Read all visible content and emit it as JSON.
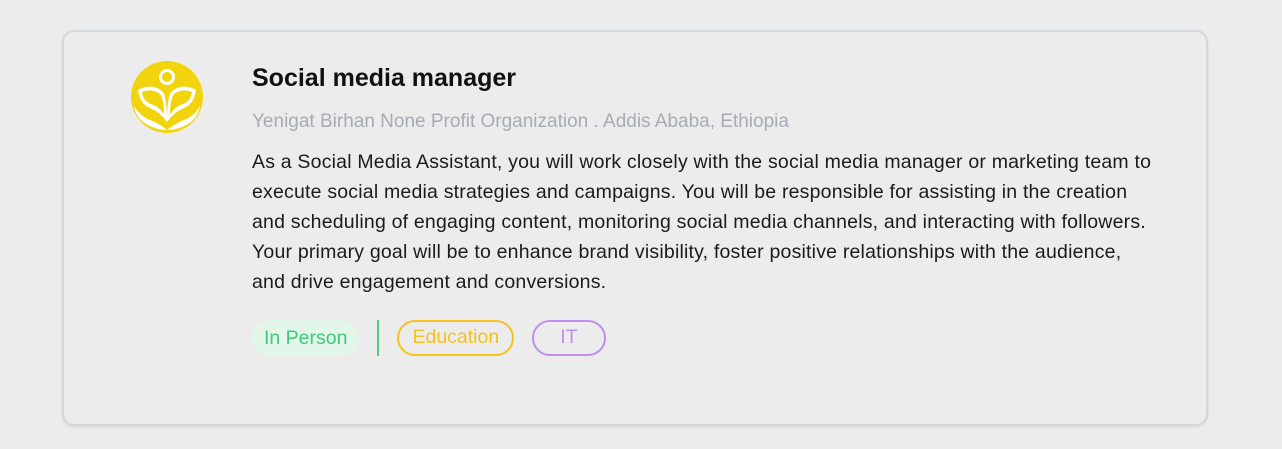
{
  "job": {
    "title": "Social media manager",
    "company_location": "Yenigat Birhan None Profit Organization . Addis Ababa, Ethiopia",
    "description": "As a Social Media Assistant, you will work closely with the social media manager or marketing team to execute social media strategies and campaigns. You will be responsible for assisting in the creation and scheduling of engaging content, monitoring social media channels, and interacting with followers. Your primary goal will be to enhance brand visibility, foster positive relationships with the audience, and drive engagement and conversions.",
    "logo_icon": "organization-logo-icon",
    "tags": {
      "work_type": "In Person",
      "category_1": "Education",
      "category_2": "IT"
    }
  },
  "colors": {
    "logo_yellow": "#f2d40c",
    "in_person_green": "#3dc97a",
    "education_yellow": "#f5c21c",
    "it_purple": "#c08ef0",
    "subtitle_gray": "#a6abb5"
  }
}
